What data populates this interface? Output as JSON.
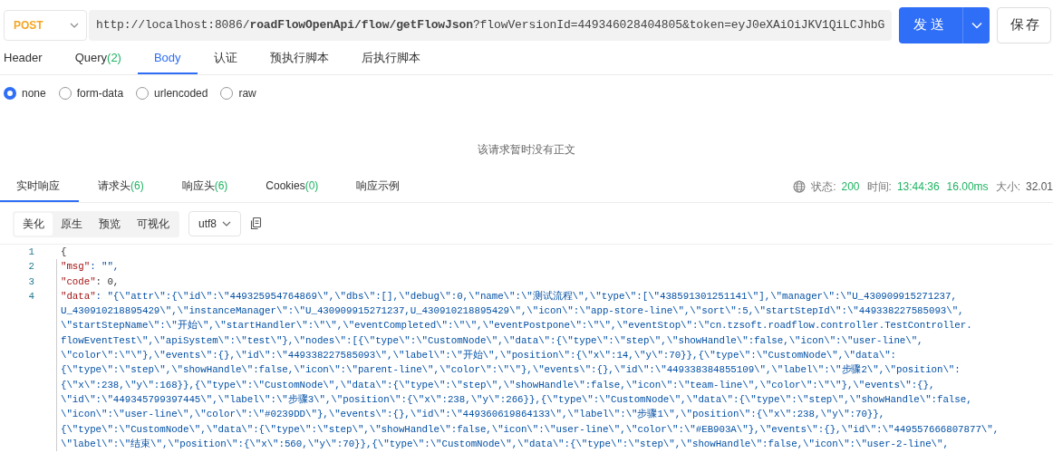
{
  "request": {
    "method": "POST",
    "url_prefix": "http://localhost:8086/",
    "url_path": "roadFlowOpenApi/flow/getFlowJson",
    "url_query": "?flowVersionId=449346028404805&token=eyJ0eXAiOiJKV1QiLCJhbG",
    "send": "发送",
    "save": "保存"
  },
  "request_tabs": [
    {
      "label": "Header",
      "selected": false
    },
    {
      "label": "Query",
      "count": "(2)",
      "selected": false
    },
    {
      "label": "Body",
      "selected": true
    },
    {
      "label": "认证",
      "selected": false
    },
    {
      "label": "预执行脚本",
      "selected": false
    },
    {
      "label": "后执行脚本",
      "selected": false
    }
  ],
  "body_types": [
    {
      "label": "none",
      "selected": true
    },
    {
      "label": "form-data",
      "selected": false
    },
    {
      "label": "urlencoded",
      "selected": false
    },
    {
      "label": "raw",
      "selected": false
    }
  ],
  "empty_body": "该请求暂时没有正文",
  "response_tabs": [
    {
      "label": "实时响应",
      "selected": true
    },
    {
      "label": "请求头",
      "count": "(6)",
      "selected": false
    },
    {
      "label": "响应头",
      "count": "(6)",
      "selected": false
    },
    {
      "label": "Cookies",
      "count": "(0)",
      "selected": false
    },
    {
      "label": "响应示例",
      "selected": false
    }
  ],
  "status": {
    "status_label": "状态:",
    "status": "200",
    "time_label": "时间:",
    "time": "13:44:36",
    "duration": "16.00ms",
    "size_label": "大小:",
    "size": "32.01"
  },
  "view_modes": [
    {
      "label": "美化",
      "selected": true
    },
    {
      "label": "原生",
      "selected": false
    },
    {
      "label": "预览",
      "selected": false
    },
    {
      "label": "可视化",
      "selected": false
    }
  ],
  "encoding": "utf8",
  "code_lines": [
    {
      "number": "1",
      "value": "{",
      "kind": "punct"
    },
    {
      "number": "2",
      "key": "\"msg\"",
      "value": ": \"\",",
      "kind": "string"
    },
    {
      "number": "3",
      "key": "\"code\"",
      "value": ": 0,",
      "kind": "number"
    },
    {
      "number": "4",
      "key": "\"data\"",
      "value": ": \"{\\\"attr\\\":{\\\"id\\\":\\\"449325954764869\\\",\\\"dbs\\\":[],\\\"debug\\\":0,\\\"name\\\":\\\"测试流程\\\",\\\"type\\\":[\\\"438591301251141\\\"],\\\"manager\\\":\\\"U_430909915271237,",
      "kind": "string"
    },
    {
      "value": "U_430910218895429\\\",\\\"instanceManager\\\":\\\"U_430909915271237,U_430910218895429\\\",\\\"icon\\\":\\\"app-store-line\\\",\\\"sort\\\":5,\\\"startStepId\\\":\\\"449338227585093\\\",",
      "kind": "string"
    },
    {
      "value": "\\\"startStepName\\\":\\\"开始\\\",\\\"startHandler\\\":\\\"\\\",\\\"eventCompleted\\\":\\\"\\\",\\\"eventPostpone\\\":\\\"\\\",\\\"eventStop\\\":\\\"cn.tzsoft.roadflow.controller.TestController.",
      "kind": "string"
    },
    {
      "value": "flowEventTest\\\",\\\"apiSystem\\\":\\\"test\\\"},\\\"nodes\\\":[{\\\"type\\\":\\\"CustomNode\\\",\\\"data\\\":{\\\"type\\\":\\\"step\\\",\\\"showHandle\\\":false,\\\"icon\\\":\\\"user-line\\\",",
      "kind": "string"
    },
    {
      "value": "\\\"color\\\":\\\"\\\"},\\\"events\\\":{},\\\"id\\\":\\\"449338227585093\\\",\\\"label\\\":\\\"开始\\\",\\\"position\\\":{\\\"x\\\":14,\\\"y\\\":70}},{\\\"type\\\":\\\"CustomNode\\\",\\\"data\\\":",
      "kind": "string"
    },
    {
      "value": "{\\\"type\\\":\\\"step\\\",\\\"showHandle\\\":false,\\\"icon\\\":\\\"parent-line\\\",\\\"color\\\":\\\"\\\"},\\\"events\\\":{},\\\"id\\\":\\\"449338384855109\\\",\\\"label\\\":\\\"步骤2\\\",\\\"position\\\":",
      "kind": "string"
    },
    {
      "value": "{\\\"x\\\":238,\\\"y\\\":168}},{\\\"type\\\":\\\"CustomNode\\\",\\\"data\\\":{\\\"type\\\":\\\"step\\\",\\\"showHandle\\\":false,\\\"icon\\\":\\\"team-line\\\",\\\"color\\\":\\\"\\\"},\\\"events\\\":{},",
      "kind": "string"
    },
    {
      "value": "\\\"id\\\":\\\"449345799397445\\\",\\\"label\\\":\\\"步骤3\\\",\\\"position\\\":{\\\"x\\\":238,\\\"y\\\":266}},{\\\"type\\\":\\\"CustomNode\\\",\\\"data\\\":{\\\"type\\\":\\\"step\\\",\\\"showHandle\\\":false,",
      "kind": "string"
    },
    {
      "value": "\\\"icon\\\":\\\"user-line\\\",\\\"color\\\":\\\"#0239DD\\\"},\\\"events\\\":{},\\\"id\\\":\\\"449360619864133\\\",\\\"label\\\":\\\"步骤1\\\",\\\"position\\\":{\\\"x\\\":238,\\\"y\\\":70}},",
      "kind": "string"
    },
    {
      "value": "{\\\"type\\\":\\\"CustomNode\\\",\\\"data\\\":{\\\"type\\\":\\\"step\\\",\\\"showHandle\\\":false,\\\"icon\\\":\\\"user-line\\\",\\\"color\\\":\\\"#EB903A\\\"},\\\"events\\\":{},\\\"id\\\":\\\"449557666807877\\\",",
      "kind": "string"
    },
    {
      "value": "\\\"label\\\":\\\"结束\\\",\\\"position\\\":{\\\"x\\\":560,\\\"y\\\":70}},{\\\"type\\\":\\\"CustomNode\\\",\\\"data\\\":{\\\"type\\\":\\\"step\\\",\\\"showHandle\\\":false,\\\"icon\\\":\\\"user-2-line\\\",",
      "kind": "string"
    }
  ]
}
